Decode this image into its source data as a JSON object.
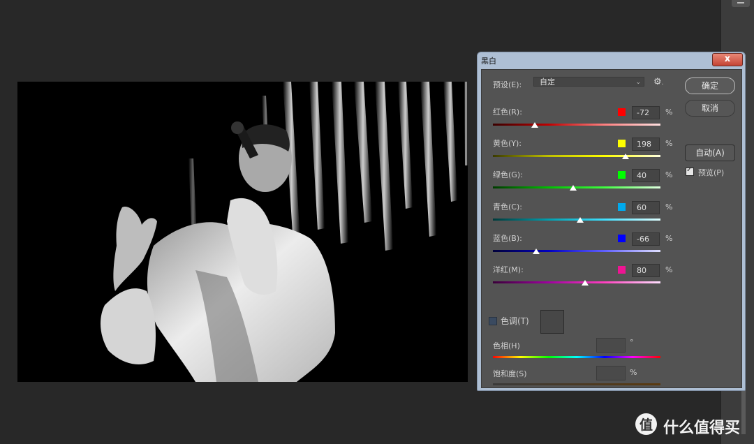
{
  "dialog": {
    "title": "黑白",
    "close_label": "x",
    "preset": {
      "label": "预设(E):",
      "value": "自定"
    },
    "buttons": {
      "ok": "确定",
      "cancel": "取消",
      "auto": "自动(A)"
    },
    "preview": {
      "label": "预览(P)",
      "checked": true
    },
    "sliders": [
      {
        "label": "红色(R):",
        "color": "#ff0000",
        "value": "-72",
        "unit": "%",
        "level": 0.25
      },
      {
        "label": "黄色(Y):",
        "color": "#ffff00",
        "value": "198",
        "unit": "%",
        "level": 0.79
      },
      {
        "label": "绿色(G):",
        "color": "#00ff00",
        "value": "40",
        "unit": "%",
        "level": 0.48
      },
      {
        "label": "青色(C):",
        "color": "#00aaee",
        "value": "60",
        "unit": "%",
        "level": 0.52
      },
      {
        "label": "蓝色(B):",
        "color": "#0000ff",
        "value": "-66",
        "unit": "%",
        "level": 0.26
      },
      {
        "label": "洋红(M):",
        "color": "#ee1493",
        "value": "80",
        "unit": "%",
        "level": 0.55
      }
    ],
    "tint": {
      "label": "色调(T)",
      "hue_label": "色相(H)",
      "hue_unit": "°",
      "saturation_label": "饱和度(S)",
      "saturation_unit": "%"
    }
  },
  "watermark": {
    "logo_char": "值",
    "text": "什么值得买"
  }
}
